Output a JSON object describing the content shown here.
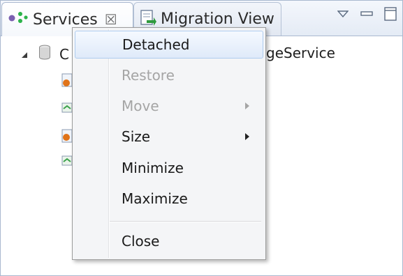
{
  "tabs": [
    {
      "label": "Services",
      "icon": "services-icon",
      "active": true
    },
    {
      "label": "Migration View",
      "icon": "migration-view-icon",
      "active": false
    }
  ],
  "tree": {
    "root_label_prefix": "C",
    "root_label_suffix": "geService"
  },
  "context_menu": {
    "items": [
      {
        "label": "Detached",
        "enabled": true,
        "highlighted": true,
        "submenu": false
      },
      {
        "label": "Restore",
        "enabled": false,
        "highlighted": false,
        "submenu": false
      },
      {
        "label": "Move",
        "enabled": false,
        "highlighted": false,
        "submenu": true
      },
      {
        "label": "Size",
        "enabled": true,
        "highlighted": false,
        "submenu": true
      },
      {
        "label": "Minimize",
        "enabled": true,
        "highlighted": false,
        "submenu": false
      },
      {
        "label": "Maximize",
        "enabled": true,
        "highlighted": false,
        "submenu": false
      },
      {
        "label": "Close",
        "enabled": true,
        "highlighted": false,
        "submenu": false
      }
    ]
  },
  "colors": {
    "highlight": "#dfeaf9",
    "disabled_text": "#a5a5a5",
    "border": "#a9b8cf"
  }
}
